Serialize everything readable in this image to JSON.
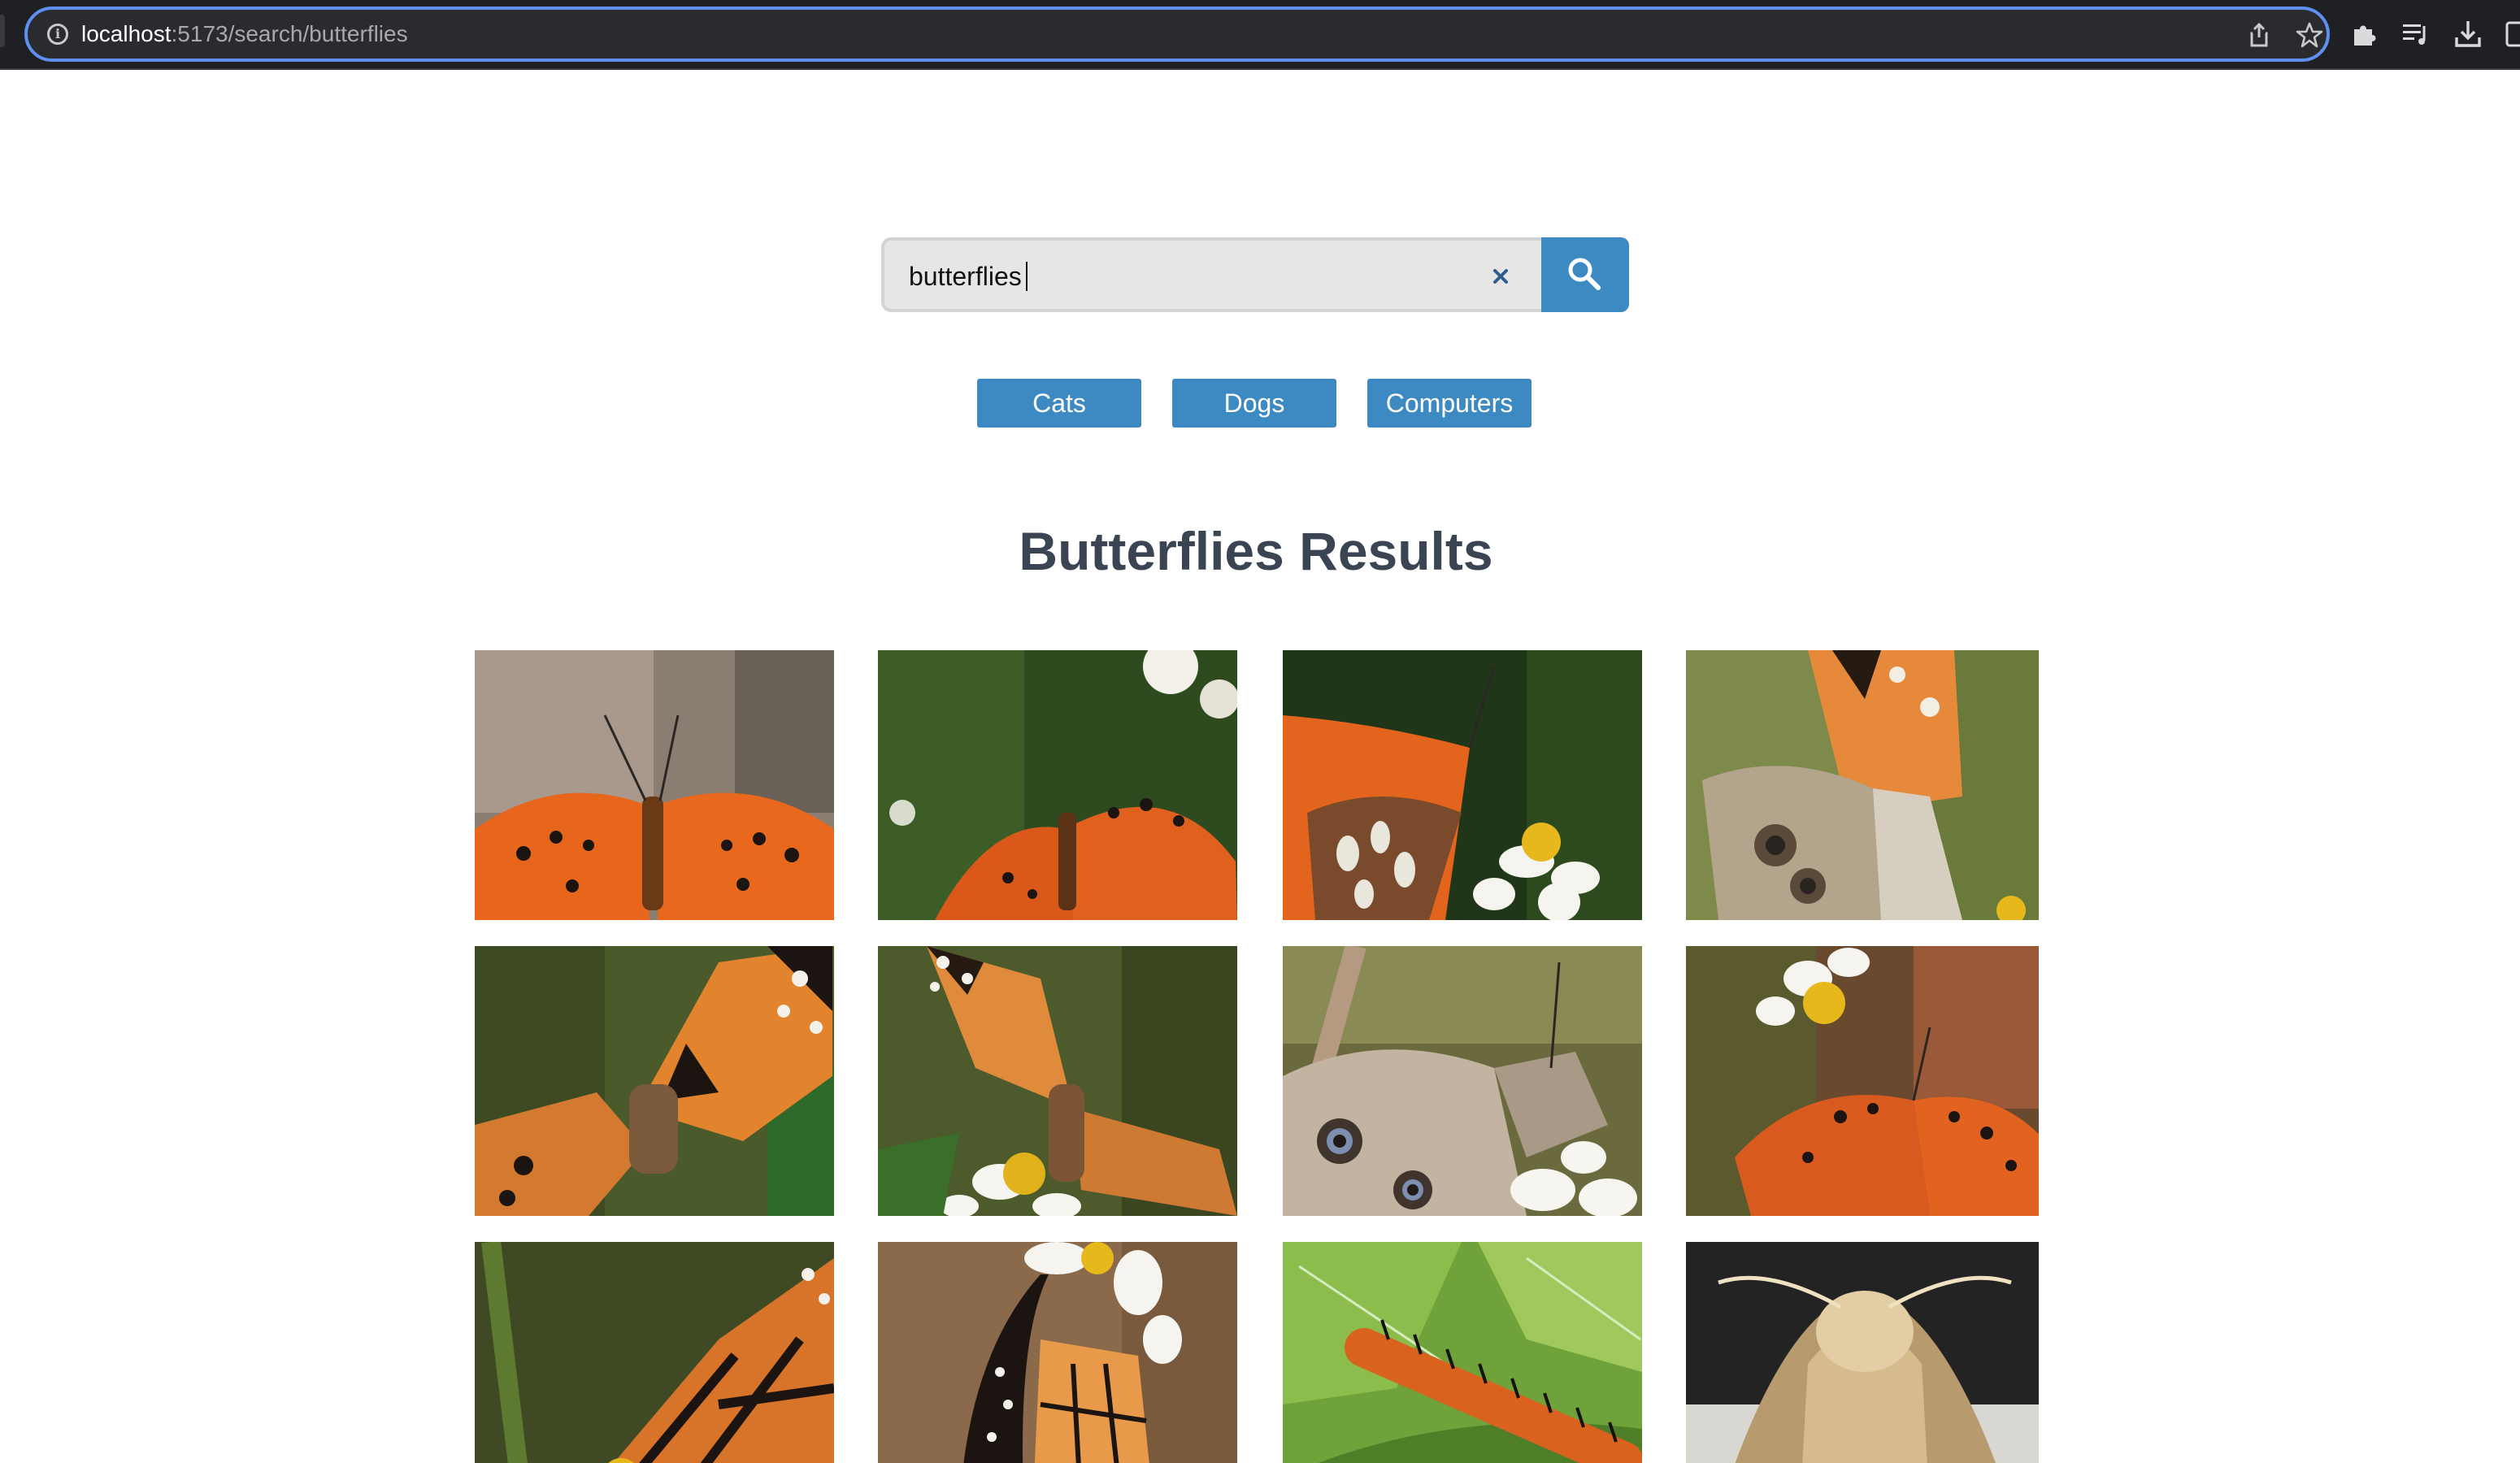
{
  "browser": {
    "url_host": "localhost",
    "url_path": ":5173/search/butterflies"
  },
  "search": {
    "value": "butterflies",
    "placeholder": "",
    "accent_color": "#3d8ac2"
  },
  "categories": [
    {
      "label": "Cats"
    },
    {
      "label": "Dogs"
    },
    {
      "label": "Computers"
    }
  ],
  "results": {
    "title": "Butterflies Results",
    "images": [
      {
        "subject": "orange butterfly with black spots, wings spread"
      },
      {
        "subject": "orange butterfly among green leaves and white flowers"
      },
      {
        "subject": "orange butterfly with silver-spotted underwing on white flower"
      },
      {
        "subject": "painted lady butterfly with eyespots"
      },
      {
        "subject": "painted lady butterfly on leaves"
      },
      {
        "subject": "painted lady butterfly on yellow flower"
      },
      {
        "subject": "butterfly underwing with eyespots on white flower"
      },
      {
        "subject": "orange butterfly on daisy"
      },
      {
        "subject": "monarch butterfly on flower"
      },
      {
        "subject": "monarch butterfly hanging from white flower"
      },
      {
        "subject": "orange spiny caterpillar on green leaf"
      },
      {
        "subject": "fuzzy tan moth"
      }
    ]
  }
}
